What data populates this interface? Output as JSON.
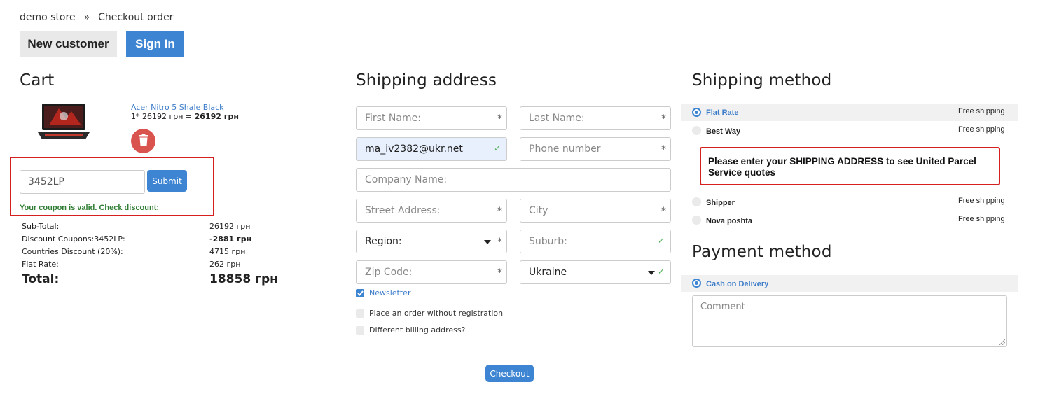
{
  "breadcrumb": {
    "store": "demo store",
    "separator": "»",
    "current": "Checkout order"
  },
  "top_buttons": {
    "new_customer": "New customer",
    "sign_in": "Sign In"
  },
  "cart": {
    "title": "Cart",
    "product": {
      "name": "Acer Nitro 5 Shale Black",
      "qty_price": "1* 26192 грн = ",
      "line_total": "26192 грн"
    },
    "coupon": {
      "value": "3452LP",
      "submit": "Submit",
      "message": "Your coupon is valid. Check discount:"
    },
    "totals": [
      {
        "label": "Sub-Total:",
        "value": "26192 грн"
      },
      {
        "label": "Discount Coupons:3452LP:",
        "value": "-2881 грн"
      },
      {
        "label": "Countries Discount (20%):",
        "value": "4715 грн"
      },
      {
        "label": "Flat Rate:",
        "value": "262 грн"
      }
    ],
    "grand_total": {
      "label": "Total:",
      "value": "18858 грн"
    }
  },
  "shipping_address": {
    "title": "Shipping address",
    "first_name": "First Name:",
    "last_name": "Last Name:",
    "email_value": "ma_iv2382@ukr.net",
    "phone": "Phone number",
    "company": "Company Name:",
    "street": "Street Address:",
    "city": "City",
    "region": "Region:",
    "suburb": "Suburb:",
    "zip": "Zip Code:",
    "country": "Ukraine",
    "required_mark": "*",
    "valid_mark": "✓",
    "newsletter": "Newsletter",
    "no_registration": "Place an order without registration",
    "billing": "Different billing address?",
    "checkout": "Checkout"
  },
  "shipping_method": {
    "title": "Shipping method",
    "methods": [
      {
        "name": "Flat Rate",
        "price": "Free shipping",
        "selected": true
      },
      {
        "name": "Best Way",
        "price": "Free shipping",
        "selected": false
      },
      {
        "name": "Shipper",
        "price": "Free shipping",
        "selected": false
      },
      {
        "name": "Nova poshta",
        "price": "Free shipping",
        "selected": false
      }
    ],
    "ups_notice": "Please enter your SHIPPING ADDRESS to see United Parcel Service quotes"
  },
  "payment_method": {
    "title": "Payment method",
    "option": "Cash on Delivery",
    "comment_placeholder": "Comment"
  },
  "colors": {
    "accent": "#3d85d2",
    "alert_border": "#d62020",
    "success": "#2e7d32",
    "danger": "#d9534f"
  }
}
